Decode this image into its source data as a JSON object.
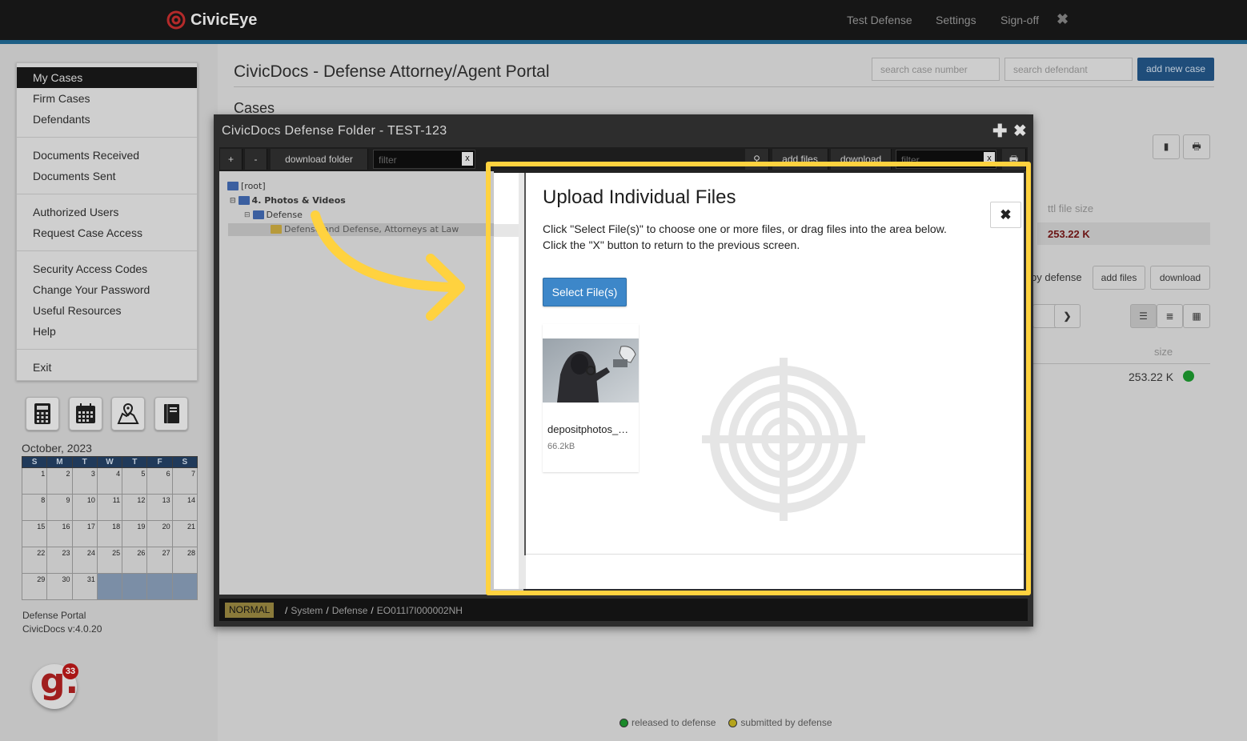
{
  "topbar": {
    "brand": "CivicEye",
    "links": [
      "Test Defense",
      "Settings",
      "Sign-off"
    ]
  },
  "menu": {
    "items": [
      "My Cases",
      "Firm Cases",
      "Defendants",
      "Documents Received",
      "Documents Sent",
      "Authorized Users",
      "Request Case Access",
      "Security Access Codes",
      "Change Your Password",
      "Useful Resources",
      "Help",
      "Exit"
    ],
    "active": "My Cases"
  },
  "tools": [
    "calculator-icon",
    "calendar-icon",
    "map-icon",
    "book-icon"
  ],
  "calendar": {
    "month": "October, 2023",
    "days": [
      "S",
      "M",
      "T",
      "W",
      "T",
      "F",
      "S"
    ],
    "weeks": [
      [
        "1",
        "2",
        "3",
        "4",
        "5",
        "6",
        "7"
      ],
      [
        "8",
        "9",
        "10",
        "11",
        "12",
        "13",
        "14"
      ],
      [
        "15",
        "16",
        "17",
        "18",
        "19",
        "20",
        "21"
      ],
      [
        "22",
        "23",
        "24",
        "25",
        "26",
        "27",
        "28"
      ],
      [
        "29",
        "30",
        "31",
        "",
        "",
        "",
        ""
      ]
    ]
  },
  "footer_info": {
    "line1": "Defense Portal",
    "line2": "CivicDocs v:4.0.20"
  },
  "gbadge": {
    "letter": "g.",
    "count": "33"
  },
  "page": {
    "title": "CivicDocs - Defense Attorney/Agent Portal",
    "section": "Cases",
    "search_case_placeholder": "search case number",
    "search_def_placeholder": "search defendant",
    "add_case": "add new case",
    "ttl_label": "ttl file size",
    "ttl_value": "253.22 K",
    "by_defense": "by defense",
    "add_files": "add files",
    "download": "download",
    "size_label": "size",
    "size_value": "253.22 K",
    "legend_released": "released to defense",
    "legend_submitted": "submitted by defense"
  },
  "dialog": {
    "title": "CivicDocs Defense Folder - TEST-123",
    "toolbar": {
      "plus": "+",
      "minus": "-",
      "download_folder": "download folder",
      "filter_placeholder": "filter",
      "clear": "x",
      "add_files": "add files",
      "download": "download"
    },
    "tree": {
      "root": "[root]",
      "photos": "4. Photos & Videos",
      "defense": "Defense",
      "file": "Defense and Defense, Attorneys at Law"
    },
    "status": {
      "mode": "NORMAL",
      "crumbs": [
        "System",
        "Defense",
        "EO011I7I000002NH"
      ]
    }
  },
  "upload": {
    "title": "Upload Individual Files",
    "instruction1": "Click \"Select File(s)\" to choose one or more files, or drag files into the area below.",
    "instruction2": "Click the \"X\" button to return to the previous screen.",
    "select_button": "Select File(s)",
    "file_name": "depositphotos_…",
    "file_size": "66.2kB"
  },
  "colors": {
    "highlight": "#ffd23f",
    "select_button": "#3d87c9",
    "accent_blue": "#1d5f86"
  }
}
